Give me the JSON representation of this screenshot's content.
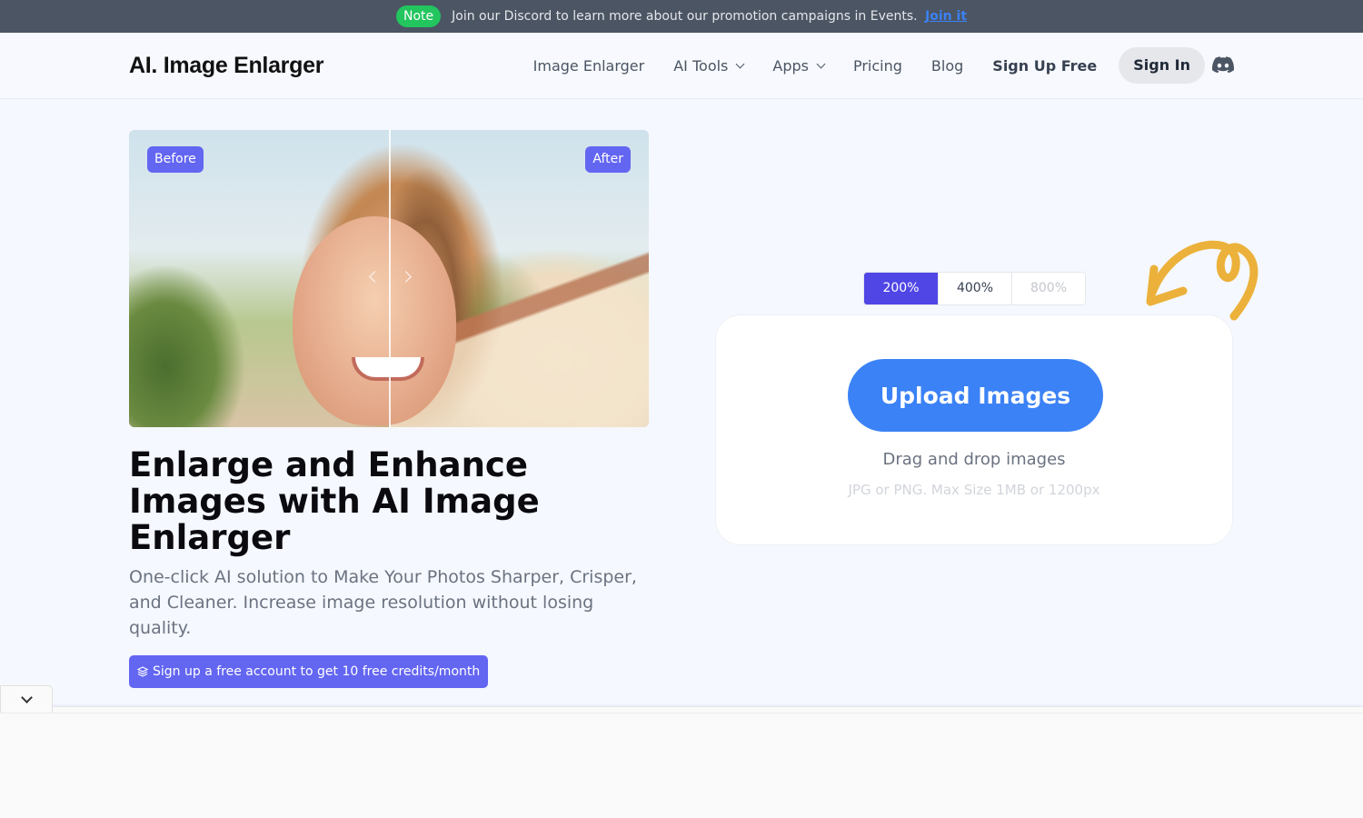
{
  "announcement": {
    "badge": "Note",
    "text": "Join our Discord to learn more about our promotion campaigns in Events.",
    "link": "Join it"
  },
  "header": {
    "logo": "AI. Image Enlarger",
    "nav": [
      {
        "label": "Image Enlarger",
        "dropdown": false
      },
      {
        "label": "AI Tools",
        "dropdown": true
      },
      {
        "label": "Apps",
        "dropdown": true
      },
      {
        "label": "Pricing",
        "dropdown": false
      },
      {
        "label": "Blog",
        "dropdown": false
      }
    ],
    "signup_label": "Sign Up Free",
    "signin_label": "Sign In",
    "discord_icon": "discord-icon"
  },
  "hero": {
    "compare": {
      "before_label": "Before",
      "after_label": "After"
    },
    "title": "Enlarge and Enhance Images with AI Image Enlarger",
    "subtitle": "One-click AI solution to Make Your Photos Sharper, Crisper, and Cleaner. Increase image resolution without losing quality.",
    "credits_button": "Sign up a free account to get 10 free credits/month"
  },
  "uploader": {
    "scales": [
      {
        "label": "200%",
        "state": "active"
      },
      {
        "label": "400%",
        "state": "normal"
      },
      {
        "label": "800%",
        "state": "disabled"
      }
    ],
    "upload_label": "Upload Images",
    "drag_text": "Drag and drop images",
    "hint": "JPG or PNG. Max Size 1MB or 1200px"
  },
  "colors": {
    "accent": "#6366f1",
    "active_scale": "#4f46e5",
    "upload": "#3b82f6",
    "note_badge": "#22c55e",
    "doodle": "#ebb13a"
  }
}
